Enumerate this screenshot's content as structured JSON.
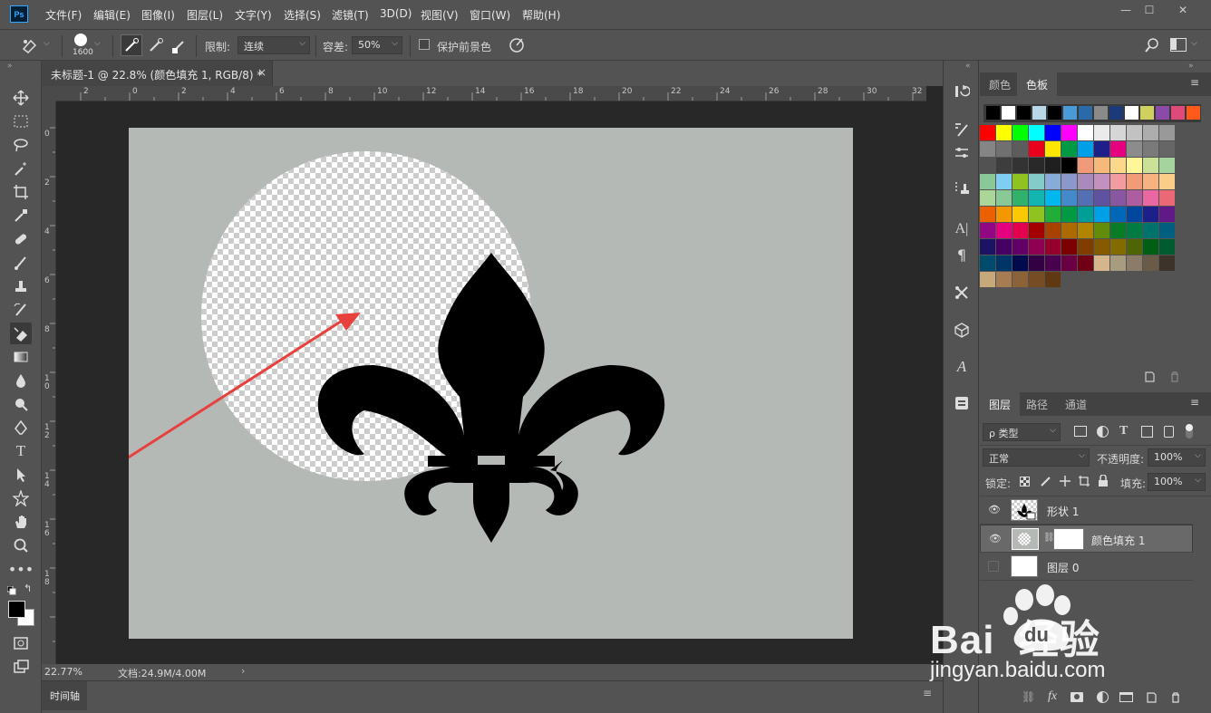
{
  "app": {
    "logo": "Ps"
  },
  "menu": [
    "文件(F)",
    "编辑(E)",
    "图像(I)",
    "图层(L)",
    "文字(Y)",
    "选择(S)",
    "滤镜(T)",
    "3D(D)",
    "视图(V)",
    "窗口(W)",
    "帮助(H)"
  ],
  "window_controls": {
    "minimize": "—",
    "maximize": "☐",
    "close": "✕"
  },
  "options": {
    "brush_size": "1600",
    "limit_label": "限制:",
    "limit_value": "连续",
    "tolerance_label": "容差:",
    "tolerance_value": "50%",
    "protect_fg_label": "保护前景色"
  },
  "document": {
    "tab_title": "未标题-1 @ 22.8% (颜色填充 1, RGB/8) *",
    "close": "×",
    "ruler_h": [
      "2",
      "0",
      "2",
      "4",
      "6",
      "8",
      "10",
      "12",
      "14",
      "16",
      "18",
      "20",
      "22",
      "24",
      "26",
      "28",
      "30",
      "32"
    ],
    "ruler_v": [
      "0",
      "2",
      "4",
      "6",
      "8",
      "10",
      "12",
      "14",
      "16",
      "18"
    ],
    "zoom": "22.77%",
    "doc_info": "文档:24.9M/4.00M",
    "canvas_color": "#b4b9b6",
    "arrow_color": "#e8403c"
  },
  "timeline": {
    "label": "时间轴"
  },
  "swatches_panel": {
    "tabs": [
      "颜色",
      "色板"
    ],
    "recent": [
      "#000000",
      "#ffffff",
      "#000000",
      "#b8d8e8",
      "#000000",
      "#4a9ad8",
      "#2a6aa8",
      "#8a8a8a",
      "#1a3a7a",
      "#ffffff",
      "#d0d060",
      "#8a4aa8",
      "#e04a7a",
      "#ff5a1a"
    ],
    "grid": [
      [
        "#ff0000",
        "#ffff00",
        "#00ff00",
        "#00ffff",
        "#0000ff",
        "#ff00ff",
        "#ffffff",
        "#ebebeb",
        "#d6d6d6",
        "#c2c2c2",
        "#adadad",
        "#999999"
      ],
      [
        "#858585",
        "#707070",
        "#5c5c5c",
        "#e8001c",
        "#ffe600",
        "#009944",
        "#00a0e9",
        "#1d2088",
        "#e4007f",
        "#8c8c8c",
        "#7a7a7a",
        "#666666"
      ],
      [
        "#525252",
        "#3d3d3d",
        "#333333",
        "#292929",
        "#1f1f1f",
        "#000000",
        "#f19a7a",
        "#f7b97a",
        "#fcd88a",
        "#fff599",
        "#cce198",
        "#a6d49e"
      ],
      [
        "#89c997",
        "#7ecef4",
        "#8fc31f",
        "#84ccc9",
        "#88abda",
        "#8c97cb",
        "#aa89bd",
        "#c490bf",
        "#f29c9f",
        "#f29b76",
        "#f6b37f",
        "#facd89"
      ],
      [
        "#acd598",
        "#89c997",
        "#31b16c",
        "#13b5b1",
        "#00b7ee",
        "#448aca",
        "#556fb5",
        "#5f52a0",
        "#8957a1",
        "#ae5da1",
        "#ea68a2",
        "#eb6877"
      ],
      [
        "#eb6100",
        "#f39800",
        "#fcc800",
        "#8fc31f",
        "#22ac38",
        "#009944",
        "#009e96",
        "#00a0e9",
        "#0068b7",
        "#00479d",
        "#1d2088",
        "#601986"
      ],
      [
        "#920783",
        "#e4007f",
        "#e5004f",
        "#a40000",
        "#a84200",
        "#ac6a00",
        "#b28500",
        "#638c0b",
        "#097c25",
        "#007b43",
        "#00736d",
        "#005f7f"
      ],
      [
        "#1b1464",
        "#440062",
        "#630068",
        "#8f0052",
        "#94002b",
        "#7d0000",
        "#7f3e00",
        "#855b00",
        "#856a00",
        "#4f6505",
        "#005e15",
        "#005b31"
      ],
      [
        "#004b6b",
        "#003567",
        "#000b4d",
        "#330044",
        "#4b004f",
        "#6a0043",
        "#6f0016",
        "#d4b58c",
        "#a89c80",
        "#8c7b68",
        "#6a5a48",
        "#3c342a"
      ],
      [
        "#c7a87a",
        "#a67c52",
        "#8c6239",
        "#754c24",
        "#603913"
      ]
    ]
  },
  "layers_panel": {
    "tabs": [
      "图层",
      "路径",
      "通道"
    ],
    "filter_label": "ρ 类型",
    "blend_mode": "正常",
    "opacity_label": "不透明度:",
    "opacity_value": "100%",
    "lock_label": "锁定:",
    "fill_label": "填充:",
    "fill_value": "100%",
    "layers": [
      {
        "name": "形状 1",
        "visible": true,
        "selected": false
      },
      {
        "name": "颜色填充 1",
        "visible": true,
        "selected": true
      },
      {
        "name": "图层 0",
        "visible": false,
        "selected": false
      }
    ]
  },
  "watermark": {
    "brand": "Bai  经验",
    "du": "du",
    "url": "jingyan.baidu.com"
  }
}
